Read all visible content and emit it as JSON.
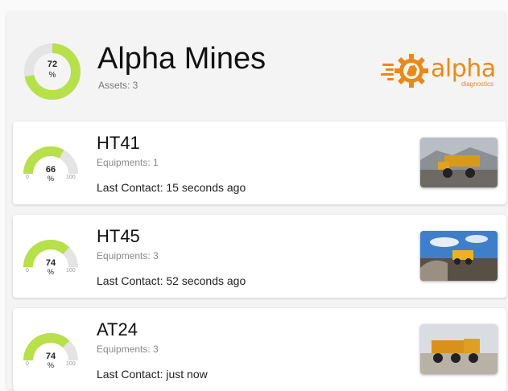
{
  "site": {
    "name": "Alpha Mines",
    "assets_label": "Assets: 3",
    "health_value": "72",
    "health_unit": "%",
    "health_fraction": 0.72
  },
  "logo": {
    "word": "alpha",
    "tagline": "diagnostics"
  },
  "assets": [
    {
      "name": "HT41",
      "equipments": "Equipments: 1",
      "last_contact": "Last Contact: 15 seconds ago",
      "gauge_value": "66",
      "gauge_unit": "%",
      "gauge_min": "0",
      "gauge_max": "100",
      "gauge_fraction": 0.66
    },
    {
      "name": "HT45",
      "equipments": "Equipments: 3",
      "last_contact": "Last Contact: 52 seconds ago",
      "gauge_value": "74",
      "gauge_unit": "%",
      "gauge_min": "0",
      "gauge_max": "100",
      "gauge_fraction": 0.74
    },
    {
      "name": "AT24",
      "equipments": "Equipments: 3",
      "last_contact": "Last Contact: just now",
      "gauge_value": "74",
      "gauge_unit": "%",
      "gauge_min": "0",
      "gauge_max": "100",
      "gauge_fraction": 0.74
    }
  ],
  "colors": {
    "gauge_fill": "#b7e04a",
    "gauge_track": "#e4e4e4",
    "brand": "#e88a1a"
  }
}
